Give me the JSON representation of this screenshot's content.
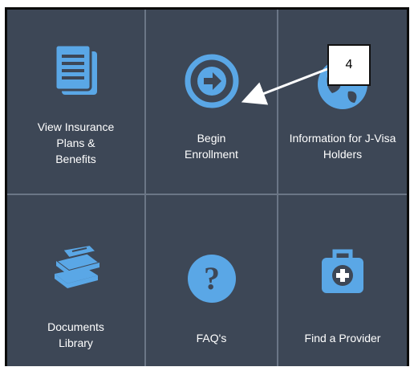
{
  "tiles": [
    {
      "id": "view-plans",
      "label": "View Insurance\nPlans &\nBenefits",
      "icon": "document-icon"
    },
    {
      "id": "begin-enrollment",
      "label": "Begin\nEnrollment",
      "icon": "arrow-circle-right-icon"
    },
    {
      "id": "j-visa",
      "label": "Information for J-Visa\nHolders",
      "icon": "globe-icon"
    },
    {
      "id": "documents-library",
      "label": "Documents\nLibrary",
      "icon": "books-icon"
    },
    {
      "id": "faqs",
      "label": "FAQ's",
      "icon": "question-icon"
    },
    {
      "id": "find-provider",
      "label": "Find a Provider",
      "icon": "medical-bag-icon"
    }
  ],
  "callout": {
    "number": "4"
  },
  "colors": {
    "panel": "#3d4756",
    "icon": "#5aa7e6",
    "text": "#ffffff"
  }
}
